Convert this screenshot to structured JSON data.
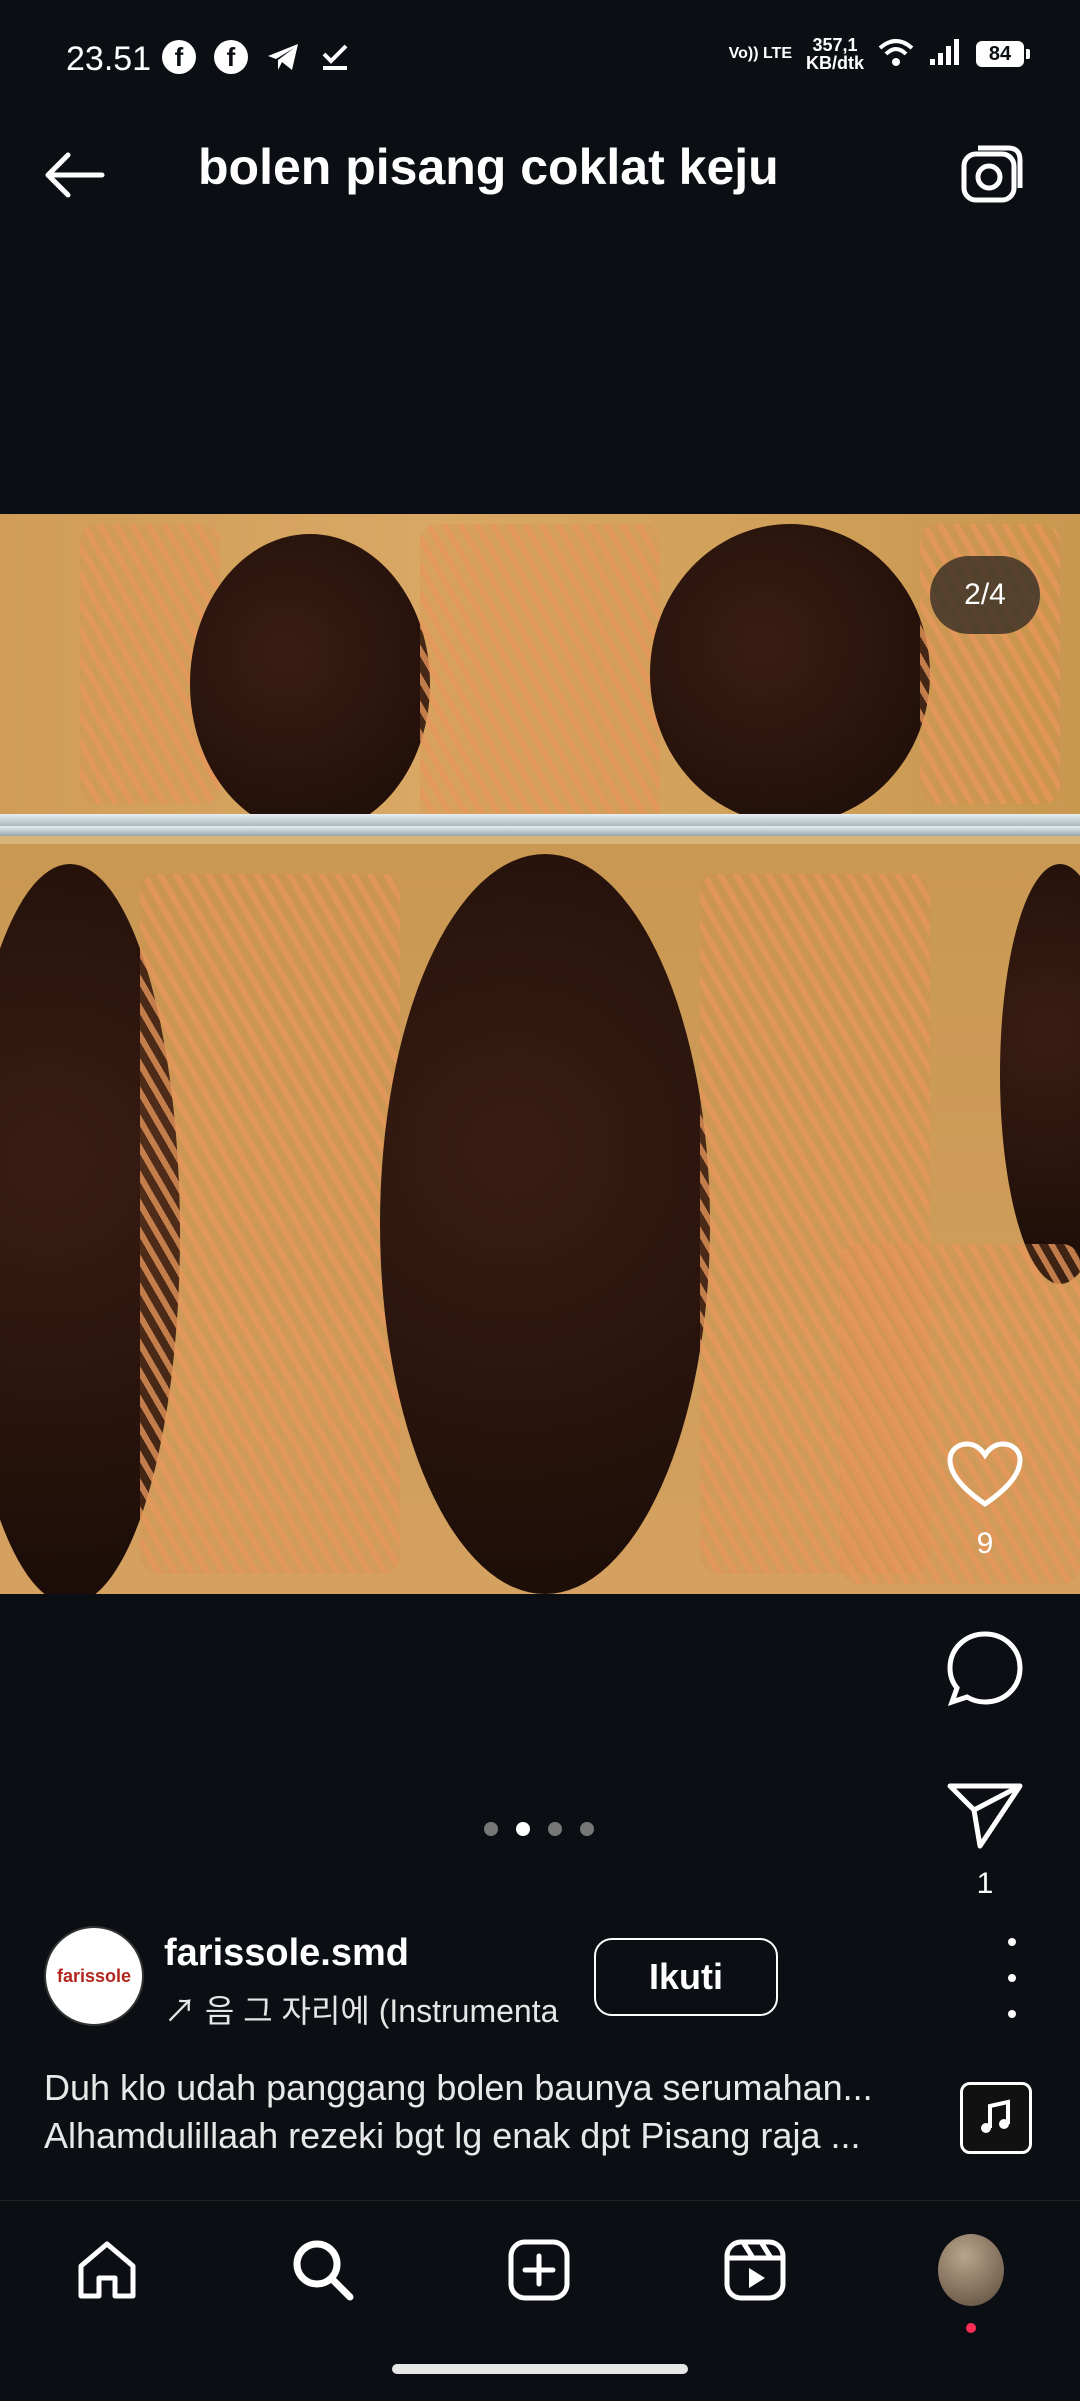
{
  "status_bar": {
    "time": "23.51",
    "network_label": "Vo)) LTE",
    "speed_value": "357,1",
    "speed_unit": "KB/dtk",
    "battery": "84"
  },
  "header": {
    "title": "bolen pisang coklat keju"
  },
  "media": {
    "pager": "2/4",
    "dots_total": 4,
    "active_dot": 2
  },
  "actions": {
    "likes": "9",
    "shares": "1"
  },
  "author": {
    "username": "farissole.smd",
    "avatar_text": "farissole",
    "music": "↗ 음 그 자리에 (Instrumenta",
    "follow_label": "Ikuti"
  },
  "caption": {
    "line1": "Duh klo udah panggang bolen baunya serumahan...",
    "line2": "Alhamdulillaah rezeki bgt lg enak dpt Pisang raja ..."
  },
  "colors": {
    "background": "#0b0f14",
    "accent": "#ff2d55"
  }
}
